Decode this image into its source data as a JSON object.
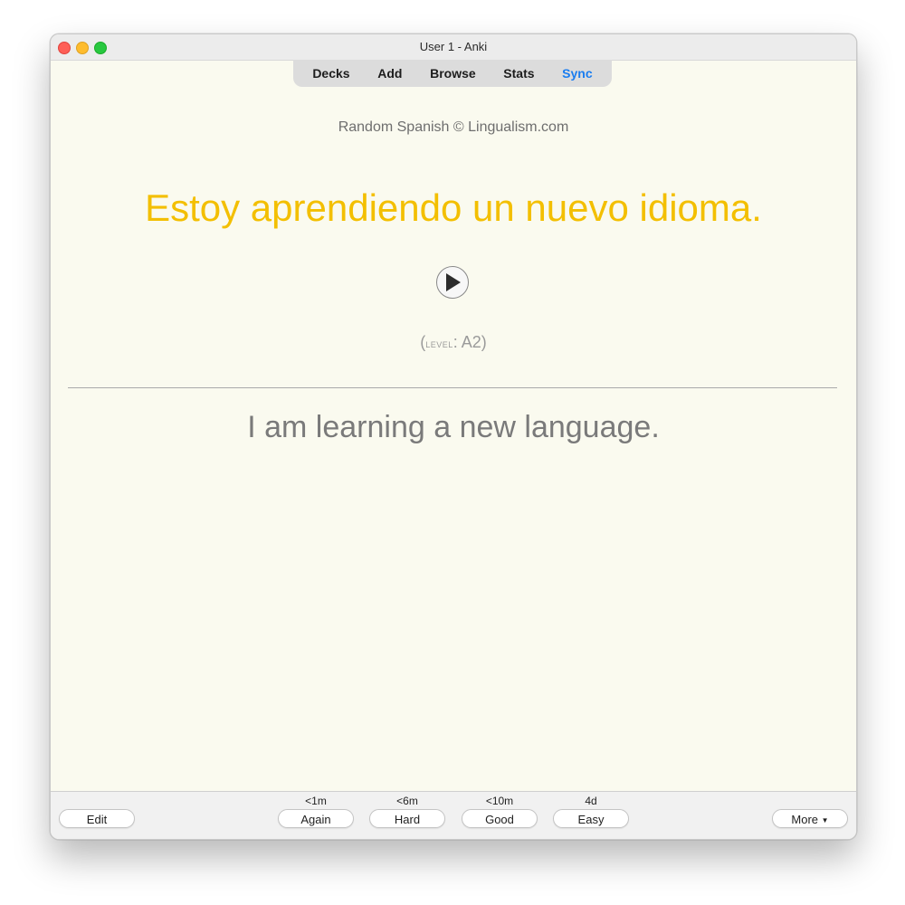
{
  "window": {
    "title": "User 1 - Anki"
  },
  "toolbar": {
    "decks": "Decks",
    "add": "Add",
    "browse": "Browse",
    "stats": "Stats",
    "sync": "Sync"
  },
  "card": {
    "attribution": "Random Spanish © Lingualism.com",
    "front": "Estoy aprendiendo un nuevo idioma.",
    "level_prefix": "(",
    "level_label": "level",
    "level_sep": ": ",
    "level_value": "A2",
    "level_suffix": ")",
    "back": "I am learning a new language.",
    "play_icon": "play-icon"
  },
  "bottom": {
    "edit": "Edit",
    "answers": [
      {
        "interval": "<1m",
        "label": "Again"
      },
      {
        "interval": "<6m",
        "label": "Hard"
      },
      {
        "interval": "<10m",
        "label": "Good"
      },
      {
        "interval": "4d",
        "label": "Easy"
      }
    ],
    "more": "More"
  },
  "colors": {
    "background": "#fafaef",
    "front_text": "#f3bf00",
    "sync": "#1a7df0"
  }
}
